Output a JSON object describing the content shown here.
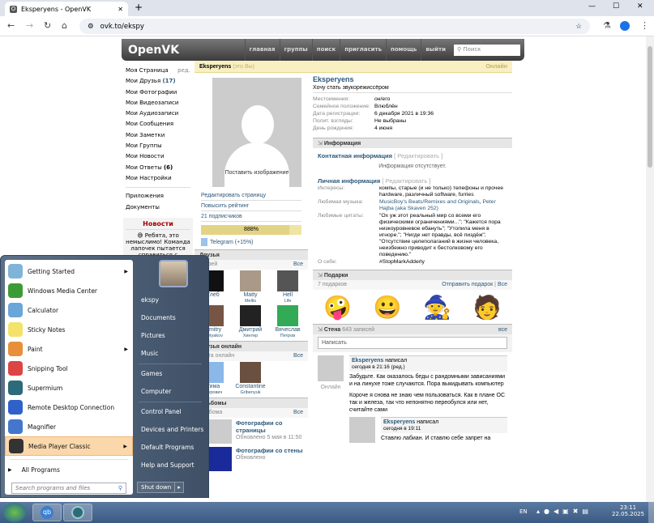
{
  "browser": {
    "tab_title": "Eksperyens - OpenVK",
    "url": "ovk.to/ekspy",
    "new_tab": "+",
    "minimize": "—",
    "maximize": "☐",
    "close": "✕"
  },
  "site": {
    "logo": "OpenVK",
    "nav": [
      "главная",
      "группы",
      "поиск",
      "пригласить",
      "помощь",
      "выйти"
    ],
    "search_placeholder": "Поиск"
  },
  "leftnav": {
    "items": [
      {
        "label": "Моя Страница",
        "extra": "ред."
      },
      {
        "label": "Мои Друзья",
        "count": "(17)"
      },
      {
        "label": "Мои Фотографии"
      },
      {
        "label": "Мои Видеозаписи"
      },
      {
        "label": "Мои Аудиозаписи"
      },
      {
        "label": "Мои Сообщения"
      },
      {
        "label": "Мои Заметки"
      },
      {
        "label": "Мои Группы"
      },
      {
        "label": "Мои Новости"
      },
      {
        "label": "Мои Ответы",
        "count": "(6)"
      },
      {
        "label": "Мои Настройки"
      }
    ],
    "extra": [
      "Приложения",
      "Документы"
    ],
    "news_title": "Новости",
    "news_text": "😅 Ребята, это немыслимо! Команда лапочек пытается справиться с"
  },
  "profile": {
    "name": "Eksperyens",
    "you": "(это Вы)",
    "online": "Онлайн",
    "status": "Хочу стать звукорежиссёром",
    "set_photo": "Поставить изображение",
    "fields": [
      [
        "Местоимения:",
        "он/его"
      ],
      [
        "Семейное положение:",
        "Влюблён"
      ],
      [
        "Дата регистрации:",
        "6 декабря 2021 в 19:36"
      ],
      [
        "Полит. взгляды:",
        "Не выбраны"
      ],
      [
        "День рождения:",
        "4 июня"
      ]
    ],
    "actions": [
      "Редактировать страницу",
      "Повысить рейтинг",
      "21 подписчиков"
    ],
    "rating": "888%",
    "rating_fill": 0.88,
    "telegram": "Telegram (+15%)"
  },
  "info": {
    "title": "Информация",
    "contact_title": "Контактная информация",
    "edit": "[ Редактировать ]",
    "no_info": "Информация отсутствует.",
    "personal_title": "Личная информация",
    "interests_k": "Интересы:",
    "interests": "компы, старые (и не только) телефоны и прочее hardware, различный software, furries",
    "music_k": "Любимая музыка:",
    "music1": "MusicBoy's Beats/Remixes and Originals",
    "music2": "Peter Hajba (aka Skaven 252)",
    "quotes_k": "Любимые цитаты:",
    "quotes": "\"Ох уж этот реальный мир со всеми его физическими ограничениями...\"; \"Кажется пора низкоуровневое ебануть\"; \"Утопила меня в игноре.\"; \"Нигде нет правды, всё пиздёж\"; \"Отсутствие целеполаганий в жизни человека, неизбежно приводит к бестолковому его поведению.\"",
    "about_k": "О себе:",
    "about": "#StopMarkAdderly"
  },
  "friends": {
    "title": "Друзья",
    "sub": "друзей",
    "all": "Все",
    "list": [
      [
        "Глеб",
        ""
      ],
      [
        "Matty",
        "Mellis"
      ],
      [
        "Hell",
        "Life"
      ],
      [
        "Dmitry",
        "Tretyakov"
      ],
      [
        "Дмитрий",
        "Хинтер"
      ],
      [
        "Вячеслав",
        "Петров"
      ]
    ]
  },
  "friends_online": {
    "title": "Друзья онлайн",
    "sub": "друга онлайн",
    "all": "Все",
    "list": [
      [
        "Тима",
        "Журович"
      ],
      [
        "Constantine",
        "Gribenyuk"
      ]
    ]
  },
  "albums": {
    "title": "Альбомы",
    "sub": "альбома",
    "all": "Все",
    "list": [
      {
        "name": "Фотографии со страницы",
        "updated": "Обновлено 5 мая в 11:50"
      },
      {
        "name": "Фотографии со стены",
        "updated": "Обновлено"
      }
    ]
  },
  "gifts": {
    "title": "Подарки",
    "count": "7 подарков",
    "send": "Отправить подарок",
    "all": "Все"
  },
  "wall": {
    "title": "Стена",
    "count": "643 записей",
    "all": "все",
    "placeholder": "Написать",
    "post": {
      "author": "Eksperyens",
      "verb": "написал",
      "date": "сегодня в 21:16 (ред.)",
      "online": "Онлайн",
      "text1": "Забудьте. Как оказалось беды с рандомными зависаниями и на линухе тоже случаются. Пора выкидывать компьютер",
      "text2": "Короче я снова не знаю чем пользоваться. Как в плане ОС так и железа, так что непонятно переобулся или нет, считайте сами"
    },
    "reply": {
      "author": "Eksperyens",
      "verb": "написал",
      "date": "сегодня в 19:11",
      "text": "Ставлю лабиан. И ставлю себе запрет на"
    }
  },
  "startmenu": {
    "programs": [
      {
        "label": "Getting Started",
        "sub": true,
        "color": "#7fb4d8"
      },
      {
        "label": "Windows Media Center",
        "color": "#3d9b35"
      },
      {
        "label": "Calculator",
        "color": "#6aa6d8"
      },
      {
        "label": "Sticky Notes",
        "color": "#f3e36a"
      },
      {
        "label": "Paint",
        "sub": true,
        "color": "#e88f3a"
      },
      {
        "label": "Snipping Tool",
        "color": "#d44"
      },
      {
        "label": "Supermium",
        "color": "#2d6a7a"
      },
      {
        "label": "Remote Desktop Connection",
        "color": "#2f62c8"
      },
      {
        "label": "Magnifier",
        "color": "#4477cc"
      },
      {
        "label": "Media Player Classic",
        "sub": true,
        "color": "#333"
      }
    ],
    "all_programs": "All Programs",
    "search_placeholder": "Search programs and files",
    "right": [
      "ekspy",
      "Documents",
      "Pictures",
      "Music",
      "Games",
      "Computer",
      "Control Panel",
      "Devices and Printers",
      "Default Programs",
      "Help and Support"
    ],
    "shutdown": "Shut down"
  },
  "taskbar": {
    "lang": "EN",
    "time": "23:11",
    "date": "22.05.2025"
  }
}
